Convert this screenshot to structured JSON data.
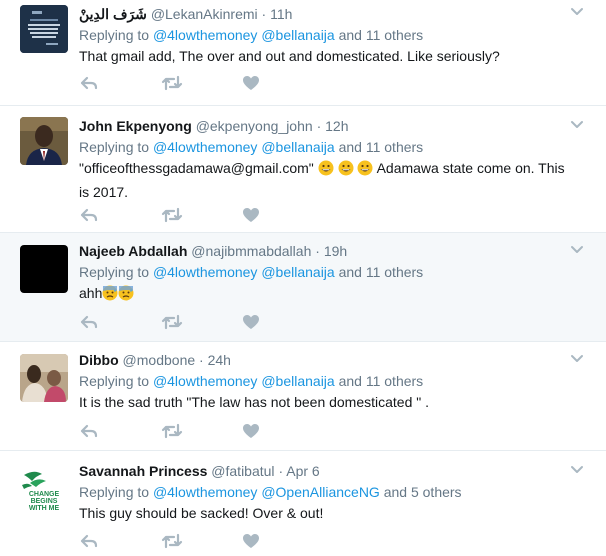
{
  "colors": {
    "link": "#1b95e0",
    "muted": "#657786",
    "text": "#14171a",
    "icon": "#aab8c2",
    "highlight": "#f5f8fa"
  },
  "reply_prefix": "Replying to",
  "and_word": "and",
  "tweets": [
    {
      "name": "شَرَف الدِينْ",
      "handle": "@LekanAkinremi",
      "time": "11h",
      "mentions": [
        "@4lowthemoney",
        "@bellanaija"
      ],
      "others": "11 others",
      "text": "That gmail add, The over and out and domesticated. Like seriously?"
    },
    {
      "name": "John Ekpenyong",
      "handle": "@ekpenyong_john",
      "time": "12h",
      "mentions": [
        "@4lowthemoney",
        "@bellanaija"
      ],
      "others": "11 others",
      "text_a": "\"officeofthessgadamawa@gmail.com\"",
      "text_b": "Adamawa state come on. This is 2017.",
      "emoji": "grinning-face-emoji"
    },
    {
      "name": "Najeeb Abdallah",
      "handle": "@najibmmabdallah",
      "time": "19h",
      "mentions": [
        "@4lowthemoney",
        "@bellanaija"
      ],
      "others": "11 others",
      "text": "ahh",
      "emoji": "anxious-sweat-face-emoji"
    },
    {
      "name": "Dibbo",
      "handle": "@modbone",
      "time": "24h",
      "mentions": [
        "@4lowthemoney",
        "@bellanaija"
      ],
      "others": "11 others",
      "text": "It is the sad truth \"The law has not been domesticated \" ."
    },
    {
      "name": "Savannah Princess",
      "handle": "@fatibatul",
      "time": "Apr 6",
      "mentions": [
        "@4lowthemoney",
        "@OpenAllianceNG"
      ],
      "others": "5 others",
      "text": "This guy should be sacked! Over & out!",
      "avatar_text": [
        "CHANGE",
        "BEGINS",
        "WITH ME"
      ]
    }
  ]
}
